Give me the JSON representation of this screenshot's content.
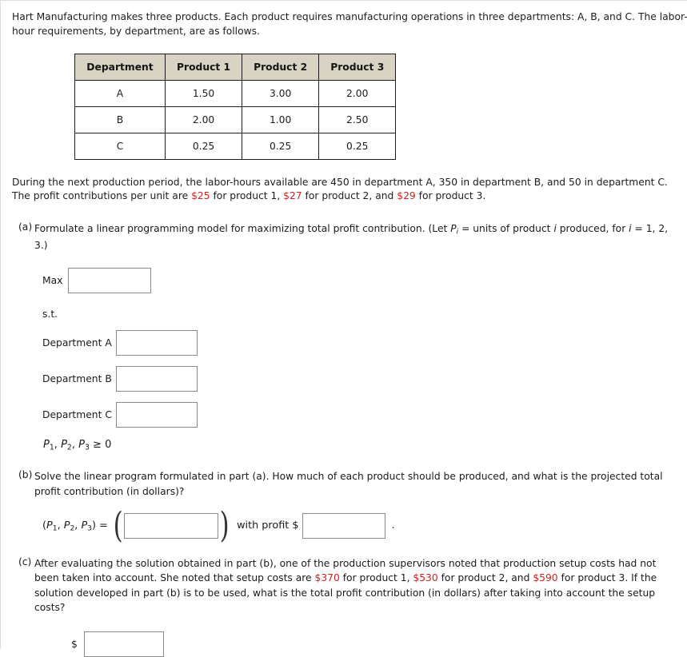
{
  "intro": {
    "line1": "Hart Manufacturing makes three products. Each product requires manufacturing operations in three departments: A, B, and C. The labor-hour requirements, by department, are as follows."
  },
  "table": {
    "headers": [
      "Department",
      "Product 1",
      "Product 2",
      "Product 3"
    ],
    "rows": [
      {
        "department": "A",
        "product1": "1.50",
        "product2": "3.00",
        "product3": "2.00"
      },
      {
        "department": "B",
        "product1": "2.00",
        "product2": "1.00",
        "product3": "2.50"
      },
      {
        "department": "C",
        "product1": "0.25",
        "product2": "0.25",
        "product3": "0.25"
      }
    ]
  },
  "availability": {
    "text_before": "During the next production period, the labor-hours available are 450 in department A, 350 in department B, and 50 in department C. The profit contributions per unit are ",
    "profit1": "$25",
    "mid1": " for product 1, ",
    "profit2": "$27",
    "mid2": " for product 2, and ",
    "profit3": "$29",
    "tail": " for product 3."
  },
  "parts": {
    "a": {
      "label": "(a)",
      "text_1": "Formulate a linear programming model for maximizing total profit contribution. (Let ",
      "var_P": "P",
      "var_sub_i": "i",
      "text_2": " = units of product ",
      "var_i": "i",
      "text_3": " produced, for ",
      "text_4": "i",
      "text_5": " = 1, 2, 3.)",
      "max_label": "Max",
      "max_value": "",
      "max_placeholder": "",
      "st_label": "s.t.",
      "constraints": [
        {
          "label": "Department A",
          "value": "",
          "placeholder": ""
        },
        {
          "label": "Department B",
          "value": "",
          "placeholder": ""
        },
        {
          "label": "Department C",
          "value": "",
          "placeholder": ""
        }
      ],
      "nonneg_P": "P",
      "nonneg_text": ", P",
      "nonneg_tail": " ≥ 0"
    },
    "b": {
      "label": "(b)",
      "text": "Solve the linear program formulated in part (a). How much of each product should be produced, and what is the projected total profit contribution (in dollars)?",
      "tuple_open": "(",
      "tuple_close": ")",
      "eq": "=",
      "tuple_value": "",
      "tuple_placeholder": "",
      "with_profit_label": "with profit $",
      "profit_value": "",
      "profit_placeholder": "",
      "period": "."
    },
    "c": {
      "label": "(c)",
      "text_before": "After evaluating the solution obtained in part (b), one of the production supervisors noted that production setup costs had not been taken into account. She noted that setup costs are ",
      "cost1": "$370",
      "mid1": " for product 1, ",
      "cost2": "$530",
      "mid2": " for product 2, and ",
      "cost3": "$590",
      "mid3": " for product 3. If the solution developed in part (b) is to be used, what is the total profit contribution (in dollars) after taking into account the setup costs?",
      "dollar_sign": "$",
      "answer_value": "",
      "answer_placeholder": ""
    }
  },
  "colors": {
    "highlight_red": "#d11f1f",
    "table_header_bg": "#d8d3c2",
    "table_border": "#1b1b1b",
    "input_border": "#8a8a8a",
    "text": "#1d1d1d"
  }
}
